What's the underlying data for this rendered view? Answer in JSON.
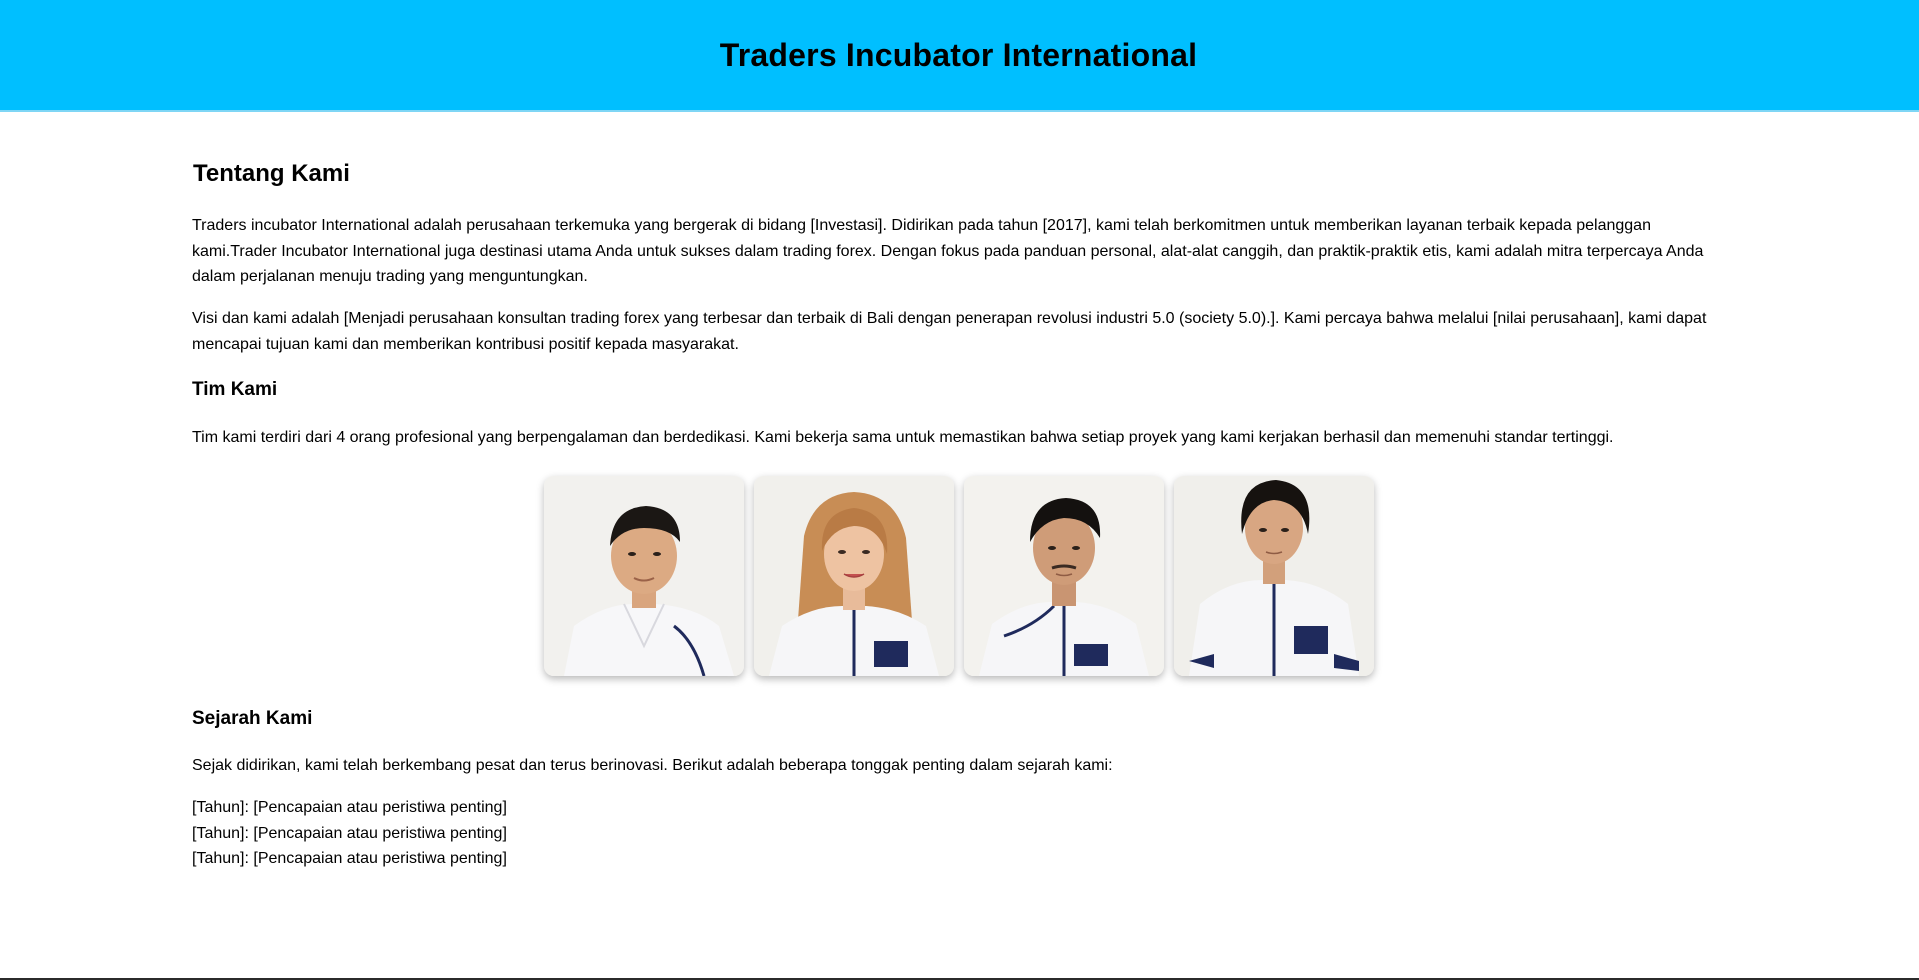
{
  "header": {
    "title": "Traders Incubator International"
  },
  "about": {
    "heading": "Tentang Kami",
    "intro": "Traders incubator International adalah perusahaan terkemuka yang bergerak di bidang [Investasi]. Didirikan pada tahun [2017], kami telah berkomitmen untuk memberikan layanan terbaik kepada pelanggan kami.Trader Incubator International juga destinasi utama Anda untuk sukses dalam trading forex. Dengan fokus pada panduan personal, alat-alat canggih, dan praktik-praktik etis, kami adalah mitra terpercaya Anda dalam perjalanan menuju trading yang menguntungkan.",
    "vision": "Visi dan kami adalah [Menjadi perusahaan konsultan trading forex yang terbesar dan terbaik di Bali dengan penerapan revolusi industri 5.0 (society 5.0).]. Kami percaya bahwa melalui [nilai perusahaan], kami dapat mencapai tujuan kami dan memberikan kontribusi positif kepada masyarakat."
  },
  "team": {
    "heading": "Tim Kami",
    "description": "Tim kami terdiri dari 4 orang profesional yang berpengalaman dan berdedikasi. Kami bekerja sama untuk memastikan bahwa setiap proyek yang kami kerjakan berhasil dan memenuhi standar tertinggi.",
    "members": [
      {
        "photo": "team-member-photo-1"
      },
      {
        "photo": "team-member-photo-2"
      },
      {
        "photo": "team-member-photo-3"
      },
      {
        "photo": "team-member-photo-4"
      }
    ]
  },
  "history": {
    "heading": "Sejarah Kami",
    "intro": "Sejak didirikan, kami telah berkembang pesat dan terus berinovasi. Berikut adalah beberapa tonggak penting dalam sejarah kami:",
    "milestones": [
      "[Tahun]: [Pencapaian atau peristiwa penting]",
      "[Tahun]: [Pencapaian atau peristiwa penting]",
      "[Tahun]: [Pencapaian atau peristiwa penting]"
    ]
  },
  "colors": {
    "header_bg": "#00bfff",
    "text": "#000000",
    "page_bg": "#ffffff",
    "uniform_navy": "#1f2a5c"
  }
}
